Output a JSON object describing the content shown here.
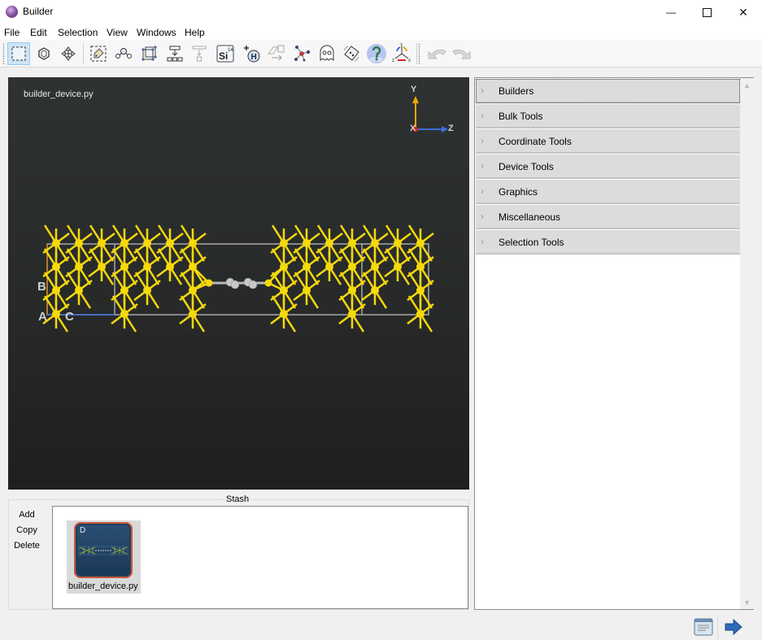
{
  "window": {
    "title": "Builder",
    "controls": {
      "minimize": "—",
      "maximize": "☐",
      "close": "✕"
    }
  },
  "menubar": [
    "File",
    "Edit",
    "Selection",
    "View",
    "Windows",
    "Help"
  ],
  "toolbar": {
    "buttons": [
      {
        "name": "rectangle-select",
        "icon": "rectangle-select-icon",
        "active": true
      },
      {
        "name": "ring-select",
        "icon": "hexagon-icon",
        "active": false
      },
      {
        "name": "move",
        "icon": "move-arrows-icon",
        "active": false
      },
      {
        "name": "tag-select",
        "icon": "tag-icon",
        "active": false
      },
      {
        "name": "bond",
        "icon": "bond-atoms-icon",
        "active": false
      },
      {
        "name": "unit-cell",
        "icon": "cube-cell-icon",
        "active": false
      },
      {
        "name": "add-layer",
        "icon": "layer-insert-icon",
        "active": false
      },
      {
        "name": "add-layer-disabled",
        "icon": "layer-insert-faded-icon",
        "active": false
      },
      {
        "name": "element",
        "icon": "element-si-icon",
        "label": "Si",
        "number": "14",
        "active": false
      },
      {
        "name": "add-hydrogen",
        "icon": "add-hydrogen-icon",
        "label": "H",
        "active": false
      },
      {
        "name": "transform",
        "icon": "transform-icon",
        "active": false
      },
      {
        "name": "molecule",
        "icon": "molecule-icon",
        "active": false
      },
      {
        "name": "ghost",
        "icon": "ghost-icon",
        "active": false
      },
      {
        "name": "rotate-view",
        "icon": "rotate-cube-icon",
        "active": false
      },
      {
        "name": "help",
        "icon": "help-question-icon",
        "active": false
      },
      {
        "name": "axes",
        "icon": "xyz-axes-icon",
        "active": false
      },
      {
        "name": "undo",
        "icon": "undo-arrow-icon",
        "active": false
      },
      {
        "name": "redo",
        "icon": "redo-arrow-icon",
        "active": false
      }
    ]
  },
  "viewport": {
    "filename": "builder_device.py",
    "axes": {
      "y": "Y",
      "z": "Z",
      "x": "X"
    },
    "lattice_labels": {
      "a": "A",
      "b": "B",
      "c": "C"
    },
    "colors": {
      "gold": "#f5d90a",
      "carbon": "#c8c8c8",
      "cell": "#a8a8a8",
      "y_axis": "#f0a800",
      "z_axis": "#3a6fd8",
      "x_axis": "#e02020"
    }
  },
  "right_panel": {
    "sections": [
      "Builders",
      "Bulk Tools",
      "Coordinate Tools",
      "Device Tools",
      "Graphics",
      "Miscellaneous",
      "Selection Tools"
    ]
  },
  "stash": {
    "title": "Stash",
    "actions": [
      "Add",
      "Copy",
      "Delete"
    ],
    "items": [
      {
        "label": "builder_device.py",
        "badge": "D"
      }
    ]
  },
  "bottom_bar": {
    "buttons": [
      {
        "name": "log",
        "icon": "document-log-icon"
      },
      {
        "name": "send-to",
        "icon": "arrow-right-icon"
      }
    ]
  }
}
